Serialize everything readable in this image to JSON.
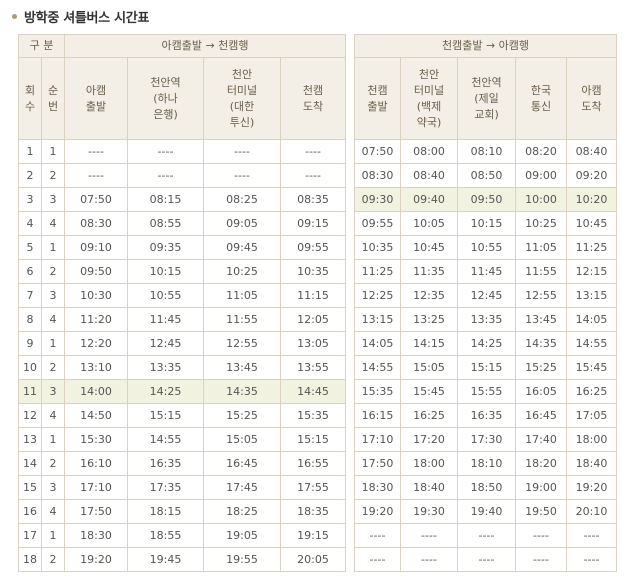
{
  "title": "방학중 셔틀버스 시간표",
  "accent_color": "#b09a78",
  "highlight_color": "#f2f2e0",
  "left": {
    "group_label": "구 분",
    "direction": "아캠출발 → 천캠행",
    "col_trip": "회\n수",
    "col_seq": "순\n번",
    "stops": [
      "아캠\n출발",
      "천안역\n(하나\n은행)",
      "천안\n터미널\n(대한\n투신)",
      "천캠\n도착"
    ],
    "highlight_row": 10,
    "rows": [
      [
        "1",
        "1",
        "----",
        "----",
        "----",
        "----"
      ],
      [
        "2",
        "2",
        "----",
        "----",
        "----",
        "----"
      ],
      [
        "3",
        "3",
        "07:50",
        "08:15",
        "08:25",
        "08:35"
      ],
      [
        "4",
        "4",
        "08:30",
        "08:55",
        "09:05",
        "09:15"
      ],
      [
        "5",
        "1",
        "09:10",
        "09:35",
        "09:45",
        "09:55"
      ],
      [
        "6",
        "2",
        "09:50",
        "10:15",
        "10:25",
        "10:35"
      ],
      [
        "7",
        "3",
        "10:30",
        "10:55",
        "11:05",
        "11:15"
      ],
      [
        "8",
        "4",
        "11:20",
        "11:45",
        "11:55",
        "12:05"
      ],
      [
        "9",
        "1",
        "12:20",
        "12:45",
        "12:55",
        "13:05"
      ],
      [
        "10",
        "2",
        "13:10",
        "13:35",
        "13:45",
        "13:55"
      ],
      [
        "11",
        "3",
        "14:00",
        "14:25",
        "14:35",
        "14:45"
      ],
      [
        "12",
        "4",
        "14:50",
        "15:15",
        "15:25",
        "15:35"
      ],
      [
        "13",
        "1",
        "15:30",
        "14:55",
        "15:05",
        "15:15"
      ],
      [
        "14",
        "2",
        "16:10",
        "16:35",
        "16:45",
        "16:55"
      ],
      [
        "15",
        "3",
        "17:10",
        "17:35",
        "17:45",
        "17:55"
      ],
      [
        "16",
        "4",
        "17:50",
        "18:15",
        "18:25",
        "18:35"
      ],
      [
        "17",
        "1",
        "18:30",
        "18:55",
        "19:05",
        "19:15"
      ],
      [
        "18",
        "2",
        "19:20",
        "19:45",
        "19:55",
        "20:05"
      ]
    ]
  },
  "right": {
    "direction": "천캠출발 → 아캠행",
    "stops": [
      "천캠\n출발",
      "천안\n터미널\n(백제\n약국)",
      "천안역\n(제일\n교회)",
      "한국\n통신",
      "아캠\n도착"
    ],
    "highlight_row": 2,
    "rows": [
      [
        "07:50",
        "08:00",
        "08:10",
        "08:20",
        "08:40"
      ],
      [
        "08:30",
        "08:40",
        "08:50",
        "09:00",
        "09:20"
      ],
      [
        "09:30",
        "09:40",
        "09:50",
        "10:00",
        "10:20"
      ],
      [
        "09:55",
        "10:05",
        "10:15",
        "10:25",
        "10:45"
      ],
      [
        "10:35",
        "10:45",
        "10:55",
        "11:05",
        "11:25"
      ],
      [
        "11:25",
        "11:35",
        "11:45",
        "11:55",
        "12:15"
      ],
      [
        "12:25",
        "12:35",
        "12:45",
        "12:55",
        "13:15"
      ],
      [
        "13:15",
        "13:25",
        "13:35",
        "13:45",
        "14:05"
      ],
      [
        "14:05",
        "14:15",
        "14:25",
        "14:35",
        "14:55"
      ],
      [
        "14:55",
        "15:05",
        "15:15",
        "15:25",
        "15:45"
      ],
      [
        "15:35",
        "15:45",
        "15:55",
        "16:05",
        "16:25"
      ],
      [
        "16:15",
        "16:25",
        "16:35",
        "16:45",
        "17:05"
      ],
      [
        "17:10",
        "17:20",
        "17:30",
        "17:40",
        "18:00"
      ],
      [
        "17:50",
        "18:00",
        "18:10",
        "18:20",
        "18:40"
      ],
      [
        "18:30",
        "18:40",
        "18:50",
        "19:00",
        "19:20"
      ],
      [
        "19:20",
        "19:30",
        "19:40",
        "19:50",
        "20:10"
      ],
      [
        "----",
        "----",
        "----",
        "----",
        "----"
      ],
      [
        "----",
        "----",
        "----",
        "----",
        "----"
      ]
    ]
  }
}
